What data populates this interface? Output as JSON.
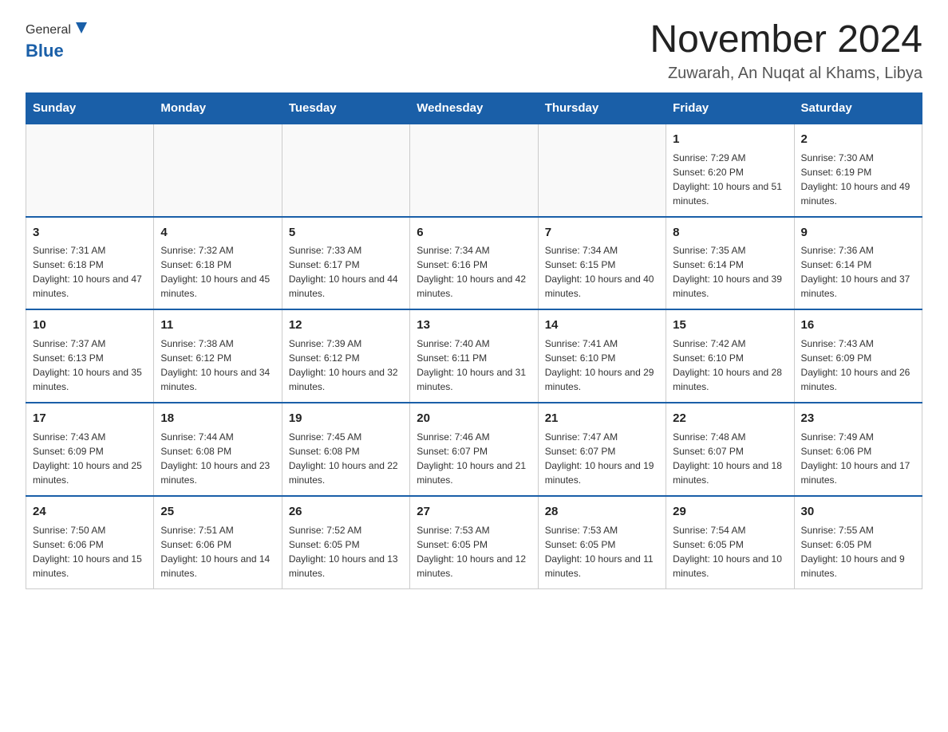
{
  "header": {
    "logo_general": "General",
    "logo_blue": "Blue",
    "month_title": "November 2024",
    "location": "Zuwarah, An Nuqat al Khams, Libya"
  },
  "days_of_week": [
    "Sunday",
    "Monday",
    "Tuesday",
    "Wednesday",
    "Thursday",
    "Friday",
    "Saturday"
  ],
  "weeks": [
    [
      {
        "day": "",
        "info": ""
      },
      {
        "day": "",
        "info": ""
      },
      {
        "day": "",
        "info": ""
      },
      {
        "day": "",
        "info": ""
      },
      {
        "day": "",
        "info": ""
      },
      {
        "day": "1",
        "info": "Sunrise: 7:29 AM\nSunset: 6:20 PM\nDaylight: 10 hours and 51 minutes."
      },
      {
        "day": "2",
        "info": "Sunrise: 7:30 AM\nSunset: 6:19 PM\nDaylight: 10 hours and 49 minutes."
      }
    ],
    [
      {
        "day": "3",
        "info": "Sunrise: 7:31 AM\nSunset: 6:18 PM\nDaylight: 10 hours and 47 minutes."
      },
      {
        "day": "4",
        "info": "Sunrise: 7:32 AM\nSunset: 6:18 PM\nDaylight: 10 hours and 45 minutes."
      },
      {
        "day": "5",
        "info": "Sunrise: 7:33 AM\nSunset: 6:17 PM\nDaylight: 10 hours and 44 minutes."
      },
      {
        "day": "6",
        "info": "Sunrise: 7:34 AM\nSunset: 6:16 PM\nDaylight: 10 hours and 42 minutes."
      },
      {
        "day": "7",
        "info": "Sunrise: 7:34 AM\nSunset: 6:15 PM\nDaylight: 10 hours and 40 minutes."
      },
      {
        "day": "8",
        "info": "Sunrise: 7:35 AM\nSunset: 6:14 PM\nDaylight: 10 hours and 39 minutes."
      },
      {
        "day": "9",
        "info": "Sunrise: 7:36 AM\nSunset: 6:14 PM\nDaylight: 10 hours and 37 minutes."
      }
    ],
    [
      {
        "day": "10",
        "info": "Sunrise: 7:37 AM\nSunset: 6:13 PM\nDaylight: 10 hours and 35 minutes."
      },
      {
        "day": "11",
        "info": "Sunrise: 7:38 AM\nSunset: 6:12 PM\nDaylight: 10 hours and 34 minutes."
      },
      {
        "day": "12",
        "info": "Sunrise: 7:39 AM\nSunset: 6:12 PM\nDaylight: 10 hours and 32 minutes."
      },
      {
        "day": "13",
        "info": "Sunrise: 7:40 AM\nSunset: 6:11 PM\nDaylight: 10 hours and 31 minutes."
      },
      {
        "day": "14",
        "info": "Sunrise: 7:41 AM\nSunset: 6:10 PM\nDaylight: 10 hours and 29 minutes."
      },
      {
        "day": "15",
        "info": "Sunrise: 7:42 AM\nSunset: 6:10 PM\nDaylight: 10 hours and 28 minutes."
      },
      {
        "day": "16",
        "info": "Sunrise: 7:43 AM\nSunset: 6:09 PM\nDaylight: 10 hours and 26 minutes."
      }
    ],
    [
      {
        "day": "17",
        "info": "Sunrise: 7:43 AM\nSunset: 6:09 PM\nDaylight: 10 hours and 25 minutes."
      },
      {
        "day": "18",
        "info": "Sunrise: 7:44 AM\nSunset: 6:08 PM\nDaylight: 10 hours and 23 minutes."
      },
      {
        "day": "19",
        "info": "Sunrise: 7:45 AM\nSunset: 6:08 PM\nDaylight: 10 hours and 22 minutes."
      },
      {
        "day": "20",
        "info": "Sunrise: 7:46 AM\nSunset: 6:07 PM\nDaylight: 10 hours and 21 minutes."
      },
      {
        "day": "21",
        "info": "Sunrise: 7:47 AM\nSunset: 6:07 PM\nDaylight: 10 hours and 19 minutes."
      },
      {
        "day": "22",
        "info": "Sunrise: 7:48 AM\nSunset: 6:07 PM\nDaylight: 10 hours and 18 minutes."
      },
      {
        "day": "23",
        "info": "Sunrise: 7:49 AM\nSunset: 6:06 PM\nDaylight: 10 hours and 17 minutes."
      }
    ],
    [
      {
        "day": "24",
        "info": "Sunrise: 7:50 AM\nSunset: 6:06 PM\nDaylight: 10 hours and 15 minutes."
      },
      {
        "day": "25",
        "info": "Sunrise: 7:51 AM\nSunset: 6:06 PM\nDaylight: 10 hours and 14 minutes."
      },
      {
        "day": "26",
        "info": "Sunrise: 7:52 AM\nSunset: 6:05 PM\nDaylight: 10 hours and 13 minutes."
      },
      {
        "day": "27",
        "info": "Sunrise: 7:53 AM\nSunset: 6:05 PM\nDaylight: 10 hours and 12 minutes."
      },
      {
        "day": "28",
        "info": "Sunrise: 7:53 AM\nSunset: 6:05 PM\nDaylight: 10 hours and 11 minutes."
      },
      {
        "day": "29",
        "info": "Sunrise: 7:54 AM\nSunset: 6:05 PM\nDaylight: 10 hours and 10 minutes."
      },
      {
        "day": "30",
        "info": "Sunrise: 7:55 AM\nSunset: 6:05 PM\nDaylight: 10 hours and 9 minutes."
      }
    ]
  ]
}
